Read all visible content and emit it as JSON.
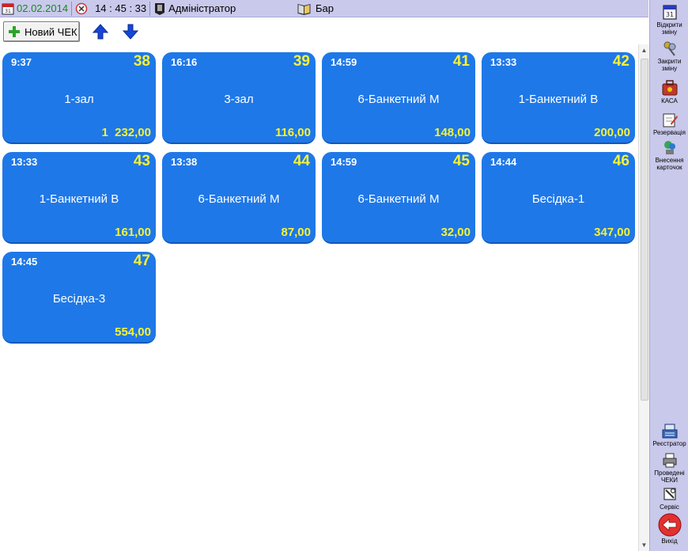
{
  "topbar": {
    "date": "02.02.2014",
    "time": "14 : 45 : 33",
    "user": "Адміністратор",
    "location": "Бар"
  },
  "toolbar": {
    "new_check_label": "Новий ЧЕК"
  },
  "orders": [
    {
      "time": "9:37",
      "number": "38",
      "hall": "1-зал",
      "sum": "1  232,00"
    },
    {
      "time": "16:16",
      "number": "39",
      "hall": "3-зал",
      "sum": "116,00"
    },
    {
      "time": "14:59",
      "number": "41",
      "hall": "6-Банкетний М",
      "sum": "148,00"
    },
    {
      "time": "13:33",
      "number": "42",
      "hall": "1-Банкетний В",
      "sum": "200,00"
    },
    {
      "time": "13:33",
      "number": "43",
      "hall": "1-Банкетний В",
      "sum": "161,00"
    },
    {
      "time": "13:38",
      "number": "44",
      "hall": "6-Банкетний М",
      "sum": "87,00"
    },
    {
      "time": "14:59",
      "number": "45",
      "hall": "6-Банкетний М",
      "sum": "32,00"
    },
    {
      "time": "14:44",
      "number": "46",
      "hall": "Бесідка-1",
      "sum": "347,00"
    },
    {
      "time": "14:45",
      "number": "47",
      "hall": "Бесідка-3",
      "sum": "554,00"
    }
  ],
  "sidebar": {
    "open_shift": "Відкрити зміну",
    "close_shift": "Закрити зміну",
    "cash": "КАСА",
    "reservation": "Резервація",
    "cards": "Внесення карточок",
    "registrar": "Реєстратор",
    "posted_checks": "Проведені ЧЕКИ",
    "service": "Сервіс",
    "exit": "Вихід"
  },
  "colors": {
    "card_bg": "#1f78e8",
    "accent_yellow": "#f7f234",
    "bar_bg": "#c9c9ec",
    "date_green": "#1a8a1a"
  }
}
